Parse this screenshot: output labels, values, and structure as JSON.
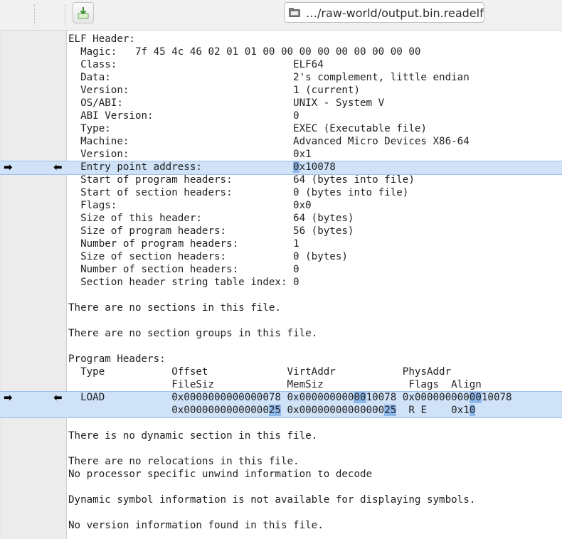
{
  "toolbar": {
    "copy_button_icon": "copy-to-editor-icon",
    "path": "…/raw-world/output.bin.readelf",
    "folder_icon": "folder-icon"
  },
  "diff_markers": {
    "right_arrow": "➡",
    "left_arrow": "⬅"
  },
  "readelf_lines": [
    "ELF Header:",
    "  Magic:   7f 45 4c 46 02 01 01 00 00 00 00 00 00 00 00 00",
    "  Class:                             ELF64",
    "  Data:                              2's complement, little endian",
    "  Version:                           1 (current)",
    "  OS/ABI:                            UNIX - System V",
    "  ABI Version:                       0",
    "  Type:                              EXEC (Executable file)",
    "  Machine:                           Advanced Micro Devices X86-64",
    "  Version:                           0x1",
    "  Entry point address:               0x10078",
    "  Start of program headers:          64 (bytes into file)",
    "  Start of section headers:          0 (bytes into file)",
    "  Flags:                             0x0",
    "  Size of this header:               64 (bytes)",
    "  Size of program headers:           56 (bytes)",
    "  Number of program headers:         1",
    "  Size of section headers:           0 (bytes)",
    "  Number of section headers:         0",
    "  Section header string table index: 0",
    "",
    "There are no sections in this file.",
    "",
    "There are no section groups in this file.",
    "",
    "Program Headers:",
    "  Type           Offset             VirtAddr           PhysAddr",
    "                 FileSiz            MemSiz              Flags  Align",
    "  LOAD           0x0000000000000078 0x0000000000010078 0x0000000000010078",
    "                 0x0000000000000025 0x0000000000000025  R E    0x10",
    "",
    "There is no dynamic section in this file.",
    "",
    "There are no relocations in this file.",
    "No processor specific unwind information to decode",
    "",
    "Dynamic symbol information is not available for displaying symbols.",
    "",
    "No version information found in this file."
  ],
  "changed_lines": [
    10,
    28,
    29
  ],
  "changed_spans": [
    {
      "line": 10,
      "start": 37,
      "end": 38
    },
    {
      "line": 28,
      "start": 47,
      "end": 49
    },
    {
      "line": 28,
      "start": 66,
      "end": 68
    },
    {
      "line": 29,
      "start": 33,
      "end": 35
    },
    {
      "line": 29,
      "start": 52,
      "end": 54
    },
    {
      "line": 29,
      "start": 66,
      "end": 68
    }
  ],
  "colors": {
    "changed_line_bg": "#cfe2f7",
    "changed_char_bg": "#8fb8ea"
  }
}
